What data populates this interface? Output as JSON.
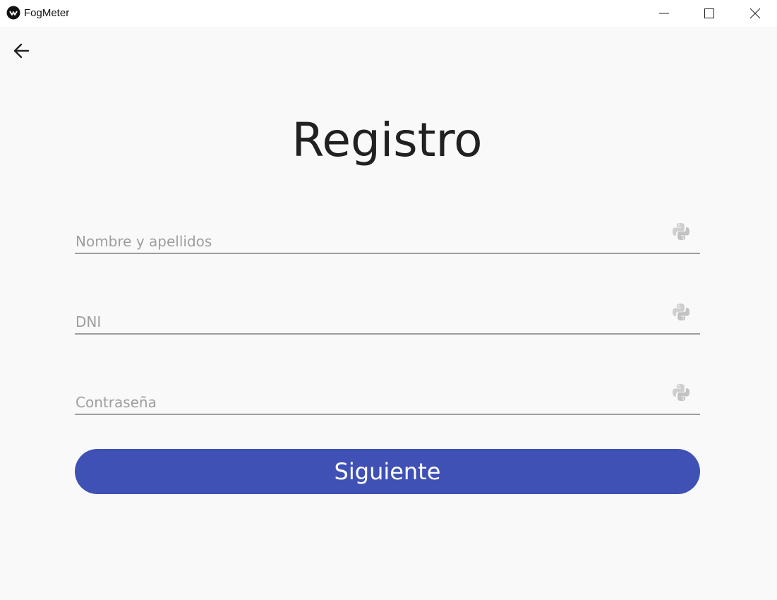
{
  "window": {
    "title": "FogMeter",
    "icon": "kivy-app-icon",
    "controls": [
      "minimize-icon",
      "maximize-icon",
      "close-icon"
    ]
  },
  "header": {
    "back_icon": "arrow-left-icon"
  },
  "main": {
    "title": "Registro",
    "fields": [
      {
        "placeholder": "Nombre y apellidos",
        "value": "",
        "icon": "python-icon"
      },
      {
        "placeholder": "DNI",
        "value": "",
        "icon": "python-icon"
      },
      {
        "placeholder": "Contraseña",
        "value": "",
        "icon": "python-icon"
      }
    ],
    "submit_label": "Siguiente"
  },
  "colors": {
    "background": "#f9f9f9",
    "titlebar": "#ffffff",
    "accent": "#3f51b5",
    "underline": "#9e9e9e",
    "placeholder": "#9e9e9e",
    "icon_muted": "#c8c8c8"
  }
}
